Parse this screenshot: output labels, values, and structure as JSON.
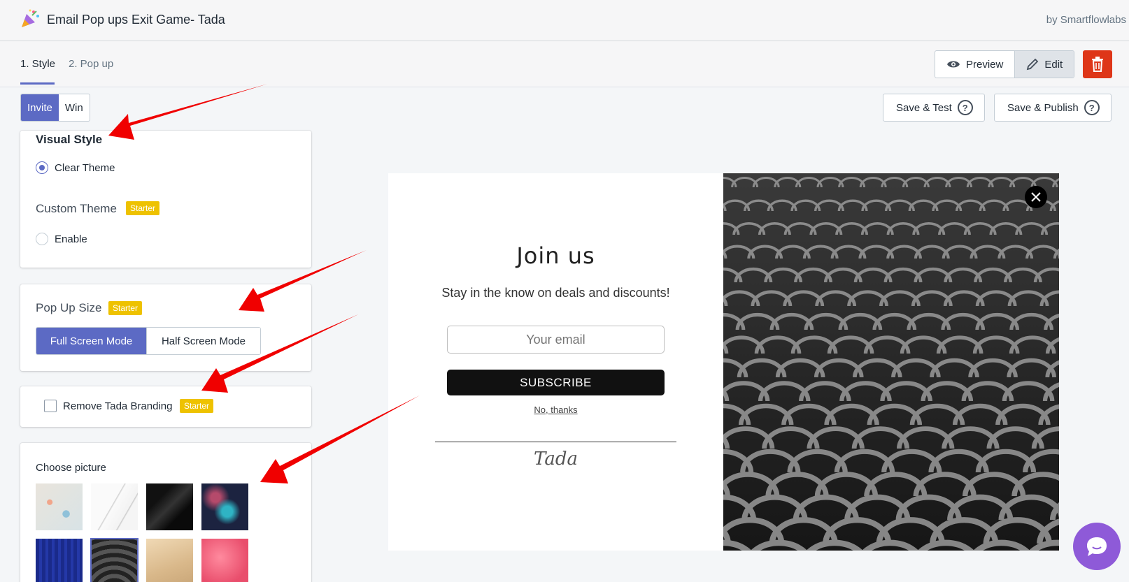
{
  "app": {
    "title": "Email Pop ups Exit Game- Tada",
    "by": "by Smartflowlabs",
    "icon": "party-popper-icon"
  },
  "tabs": [
    {
      "label": "1. Style",
      "active": true
    },
    {
      "label": "2. Pop up",
      "active": false
    }
  ],
  "view_toggle": {
    "preview_label": "Preview",
    "edit_label": "Edit",
    "selected": "Edit"
  },
  "mode_toggle": {
    "invite_label": "Invite",
    "win_label": "Win",
    "selected": "Invite"
  },
  "actions": {
    "save_test_label": "Save & Test",
    "save_publish_label": "Save & Publish"
  },
  "visual_style": {
    "heading": "Visual Style",
    "clear_theme_label": "Clear Theme",
    "clear_theme_selected": true,
    "custom_theme_label": "Custom Theme",
    "custom_theme_badge": "Starter",
    "enable_label": "Enable",
    "enable_selected": false
  },
  "popup_size": {
    "label": "Pop Up Size",
    "badge": "Starter",
    "full_label": "Full Screen Mode",
    "half_label": "Half Screen Mode",
    "selected": "Full Screen Mode"
  },
  "branding": {
    "label": "Remove Tada Branding",
    "badge": "Starter",
    "checked": false
  },
  "pictures": {
    "label": "Choose picture",
    "selected_index": 5
  },
  "popup_preview": {
    "title": "Join us",
    "subtitle": "Stay in the know on deals and discounts!",
    "email_placeholder": "Your email",
    "subscribe_label": "SUBSCRIBE",
    "no_thanks_label": "No, thanks",
    "brand_logo": "Tada"
  },
  "colors": {
    "accent": "#5c6ac4",
    "danger": "#de3618",
    "badge": "#eec200",
    "chat": "#8e5ad8",
    "annotation_arrow": "#ff0000"
  }
}
